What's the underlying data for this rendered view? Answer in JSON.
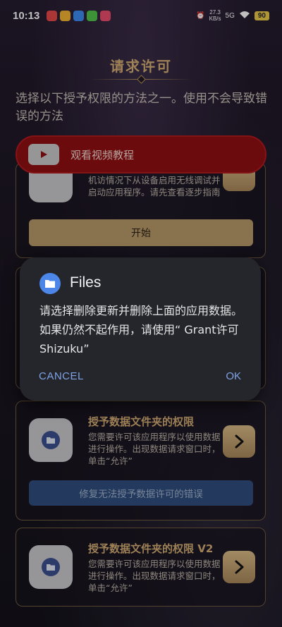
{
  "status_bar": {
    "time": "10:13",
    "speed_value": "27.3",
    "speed_unit": "KB/s",
    "network": "5G",
    "battery": "90"
  },
  "header": {
    "title": "请求许可",
    "subtitle": "选择以下授予权限的方法之一。使用不会导致错误的方法"
  },
  "video_banner": {
    "label": "观看视频教程"
  },
  "cards": [
    {
      "desc": "机访情况下从设备启用无线调试并启动应用程序。请先查看逐步指南",
      "button": "开始"
    },
    {
      "title": "授予数据文件夹的权限",
      "desc": "您需要许可该应用程序以使用数据进行操作。出现数据请求窗口时，单击“允许”",
      "button": "修复无法授予数据许可的错误"
    },
    {
      "title": "授予数据文件夹的权限 V2",
      "desc": "您需要许可该应用程序以使用数据进行操作。出现数据请求窗口时，单击“允许”"
    }
  ],
  "dialog": {
    "app": "Files",
    "message": "请选择删除更新并删除上面的应用数据。如果仍然不起作用，请使用“ Grant许可Shizuku”",
    "cancel": "CANCEL",
    "ok": "OK"
  },
  "colors": {
    "accent_gold": "#d3ad74",
    "video_red": "#8f0f12",
    "dialog_bg": "#25262c",
    "link_blue": "#7ea3e6"
  }
}
